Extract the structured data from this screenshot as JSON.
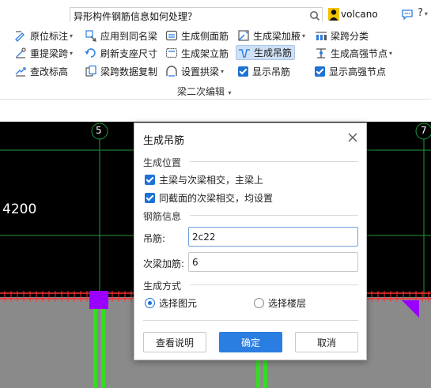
{
  "topbar": {
    "search_text": "异形构件钢筋信息如何处理？",
    "username": "volcano",
    "help": "?"
  },
  "ribbon": {
    "items": [
      {
        "label": "原位标注",
        "icon": "beam-annotate-icon"
      },
      {
        "label": "应用到同名梁",
        "icon": "apply-same-name-icon"
      },
      {
        "label": "生成侧面筋",
        "icon": "side-rebar-icon"
      },
      {
        "label": "生成梁加腋",
        "icon": "beam-haunch-icon"
      },
      {
        "label": "梁跨分类",
        "icon": "span-classify-icon"
      },
      {
        "label": "重提梁跨",
        "icon": "re-extract-span-icon"
      },
      {
        "label": "刷新支座尺寸",
        "icon": "refresh-support-icon"
      },
      {
        "label": "生成架立筋",
        "icon": "erection-rebar-icon"
      },
      {
        "label": "生成吊筋",
        "icon": "hanger-rebar-icon"
      },
      {
        "label": "生成高强节点",
        "icon": "high-strength-node-icon"
      },
      {
        "label": "查改标高",
        "icon": "elevation-icon"
      },
      {
        "label": "梁跨数据复制",
        "icon": "span-copy-icon"
      },
      {
        "label": "设置拱梁",
        "icon": "arch-beam-icon"
      }
    ],
    "checkboxes": [
      {
        "label": "显示吊筋",
        "checked": true
      },
      {
        "label": "显示高强节点",
        "checked": true
      }
    ],
    "group_label": "梁二次编辑"
  },
  "canvas": {
    "axis_labels": [
      "5",
      "7"
    ],
    "dimension": "4200"
  },
  "dialog": {
    "title": "生成吊筋",
    "section_position": "生成位置",
    "pos_options": [
      {
        "label": "主梁与次梁相交，主梁上",
        "checked": true
      },
      {
        "label": "同截面的次梁相交，均设置",
        "checked": true
      }
    ],
    "section_rebar": "钢筋信息",
    "hanger_label": "吊筋:",
    "hanger_value": "2c22",
    "extra_label": "次梁加筋:",
    "extra_value": "6",
    "section_method": "生成方式",
    "method_options": [
      {
        "label": "选择图元",
        "selected": true
      },
      {
        "label": "选择楼层",
        "selected": false
      }
    ],
    "btn_help": "查看说明",
    "btn_ok": "确定",
    "btn_cancel": "取消"
  },
  "colors": {
    "accent": "#2a7de1",
    "canvas_bg": "#000000",
    "grid_line": "#1f9a3a",
    "rebar_green": "#33dd22",
    "purple": "#9a00ff",
    "red": "#ff3030"
  }
}
